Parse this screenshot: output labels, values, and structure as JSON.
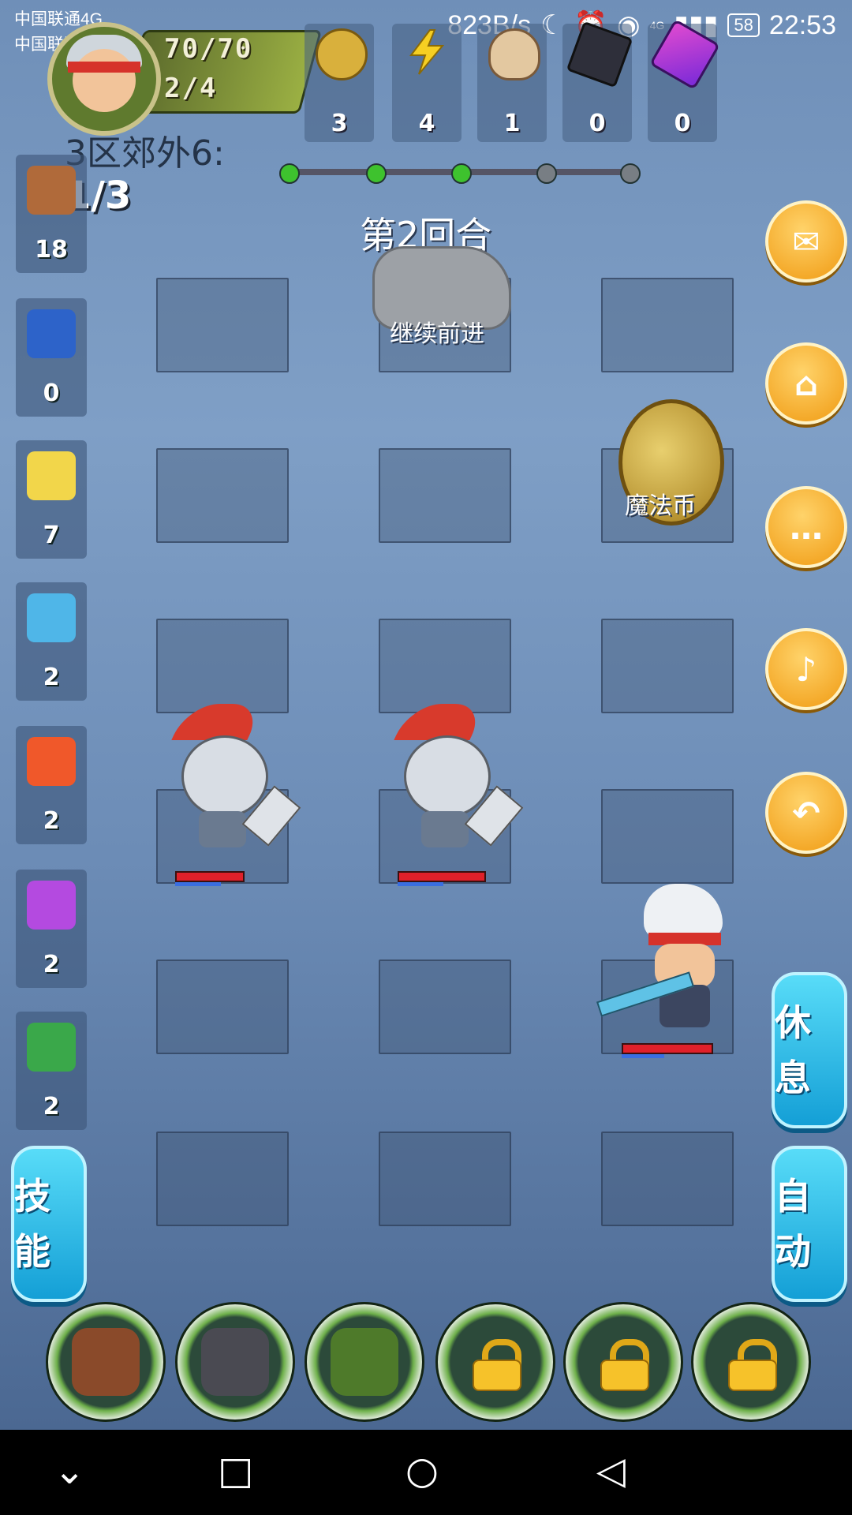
{
  "status_bar": {
    "carrier_1": "中国联通4G",
    "carrier_2": "中国联通",
    "net_speed": "823B/s",
    "network": "4G",
    "battery": "58",
    "time": "22:53"
  },
  "hero": {
    "hp_text": "70/70",
    "ap_text": "2/4"
  },
  "resources": [
    {
      "name": "gold-coin",
      "value": "3"
    },
    {
      "name": "energy",
      "value": "4"
    },
    {
      "name": "shell",
      "value": "1"
    },
    {
      "name": "ore",
      "value": "0"
    },
    {
      "name": "crystal",
      "value": "0"
    }
  ],
  "stage": {
    "name": "3区郊外6:",
    "count": "1/3",
    "round": "第2回合",
    "progress_total": 5,
    "progress_done": 3
  },
  "skills": [
    {
      "icon": "fist-icon",
      "value": "18",
      "color": "#b06a3a"
    },
    {
      "icon": "shield-icon",
      "value": "0",
      "color": "#2d63c9"
    },
    {
      "icon": "flame-spirit-icon",
      "value": "7",
      "color": "#f2d64a"
    },
    {
      "icon": "water-wave-icon",
      "value": "2",
      "color": "#4fb6e8"
    },
    {
      "icon": "fireball-icon",
      "value": "2",
      "color": "#f0582a"
    },
    {
      "icon": "lightning-icon",
      "value": "2",
      "color": "#b44ae0"
    },
    {
      "icon": "poison-icon",
      "value": "2",
      "color": "#3aa84a"
    }
  ],
  "board": {
    "hint_label": "继续前进",
    "coin_label": "魔法币"
  },
  "buttons": {
    "rest": "休息",
    "auto": "自动",
    "skills": "技能"
  },
  "items": [
    {
      "icon": "steak-icon",
      "locked": false
    },
    {
      "icon": "furnace-icon",
      "locked": false
    },
    {
      "icon": "spiked-shell-icon",
      "locked": false
    },
    {
      "icon": "lock-icon",
      "locked": true
    },
    {
      "icon": "lock-icon",
      "locked": true
    },
    {
      "icon": "lock-icon",
      "locked": true
    }
  ]
}
